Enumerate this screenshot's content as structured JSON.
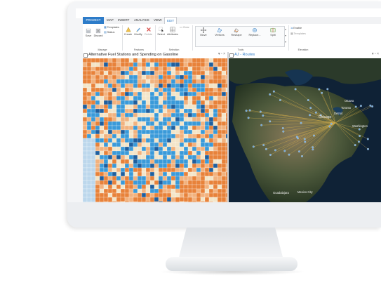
{
  "ribbon": {
    "tabs": [
      "PROJECT",
      "MAP",
      "INSERT",
      "ANALYSIS",
      "VIEW",
      "EDIT"
    ],
    "active_tab": "EDIT",
    "buttons": {
      "save": "Save",
      "discard": "Discard",
      "templates": "Templates",
      "status": "Status",
      "create": "Create",
      "modify": "Modify",
      "delete": "Delete",
      "select": "Select",
      "attributes": "Attributes",
      "clear": "Clear",
      "move": "Move",
      "vertices": "Vertices",
      "reshape": "Reshape",
      "replace": "Replace...",
      "split": "Split",
      "enable": "Enable",
      "templates2": "Templates"
    },
    "groups": {
      "manage": "Manage",
      "features": "Features",
      "selection": "Selection",
      "tools": "Tools",
      "elevation": "Elevation"
    }
  },
  "left_pane": {
    "title": "Alternative Fuel Stations and Spending on Gasoline"
  },
  "right_pane": {
    "title": "AJ - Routes"
  },
  "map_labels": {
    "ottawa": "Ottawa",
    "toronto": "Toronto",
    "detroit": "Detroit",
    "chicago": "Chicago",
    "washington": "Washington",
    "guadalajara": "Guadalajara",
    "mexico_city": "Mexico\nCity"
  },
  "colors": {
    "orange": "#e8823a",
    "light_orange": "#f2b27e",
    "cream": "#f3e5c8",
    "blue": "#3a9ad9",
    "dark_blue": "#1f5f9e",
    "ribbon_blue": "#2d7cc9"
  }
}
